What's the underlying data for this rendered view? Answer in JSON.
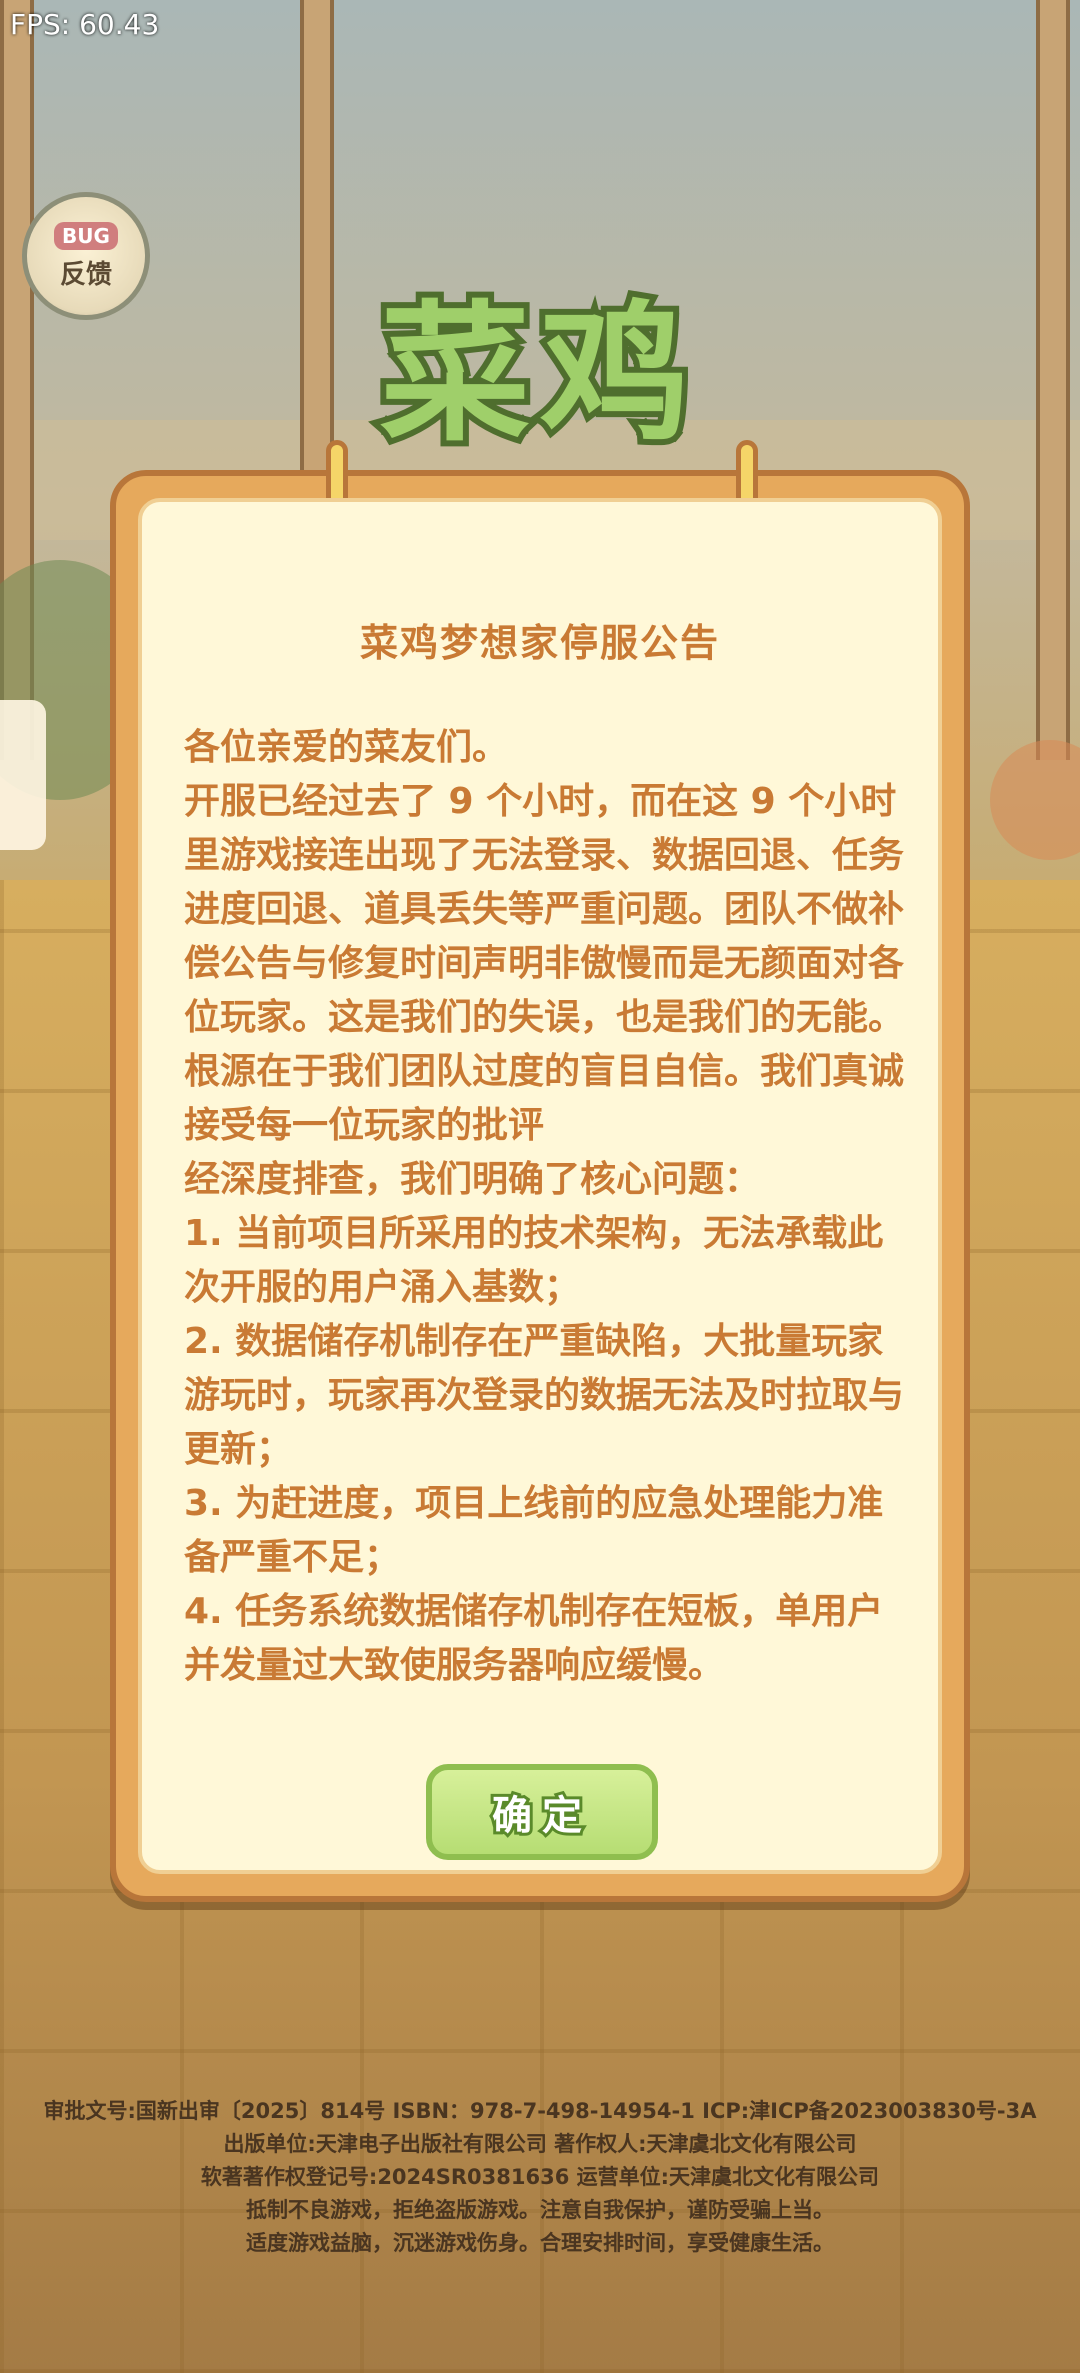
{
  "fps": "FPS: 60.43",
  "feedback": {
    "tag": "BUG",
    "label": "反馈"
  },
  "logo_text": "菜鸡",
  "notice": {
    "title": "菜鸡梦想家停服公告",
    "lines": [
      "各位亲爱的菜友们。",
      "开服已经过去了 9 个小时，而在这 9 个小时里游戏接连出现了无法登录、数据回退、任务进度回退、道具丢失等严重问题。团队不做补偿公告与修复时间声明非傲慢而是无颜面对各位玩家。这是我们的失误，也是我们的无能。根源在于我们团队过度的盲目自信。我们真诚接受每一位玩家的批评",
      "经深度排查，我们明确了核心问题：",
      "1. 当前项目所采用的技术架构，无法承载此次开服的用户涌入基数；",
      "2. 数据储存机制存在严重缺陷，大批量玩家游玩时，玩家再次登录的数据无法及时拉取与更新；",
      "3. 为赶进度，项目上线前的应急处理能力准备严重不足；",
      "4. 任务系统数据储存机制存在短板，单用户并发量过大致使服务器响应缓慢。"
    ],
    "confirm_label": "确定"
  },
  "footer": [
    "审批文号:国新出审〔2025〕814号   ISBN：978-7-498-14954-1  ICP:津ICP备2023003830号-3A",
    "出版单位:天津电子出版社有限公司   著作权人:天津虞北文化有限公司",
    "软著著作权登记号:2024SR0381636   运营单位:天津虞北文化有限公司",
    "抵制不良游戏，拒绝盗版游戏。注意自我保护，谨防受骗上当。",
    "适度游戏益脑，沉迷游戏伤身。合理安排时间，享受健康生活。"
  ]
}
